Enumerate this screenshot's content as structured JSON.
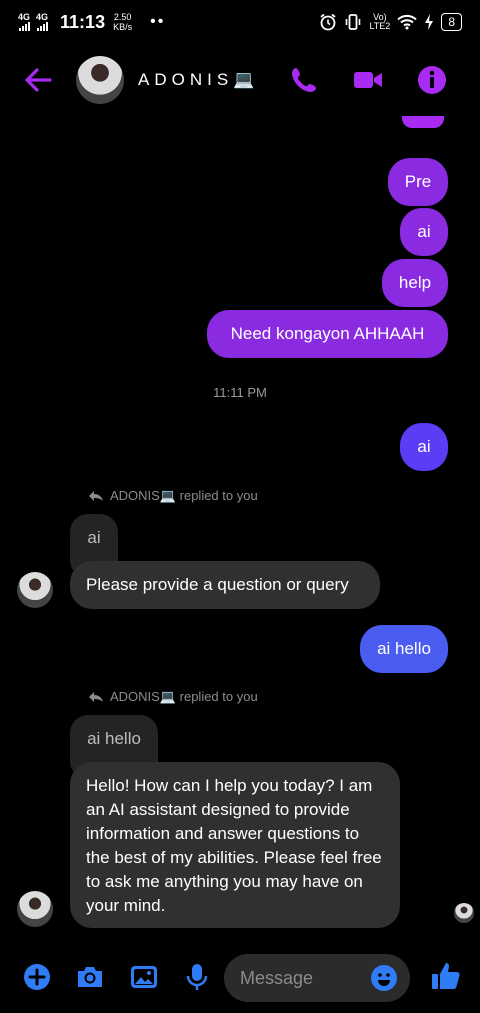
{
  "status": {
    "net1": "4G",
    "net2": "4G",
    "time": "11:13",
    "speed_value": "2.50",
    "speed_unit": "KB/s",
    "dots": "••",
    "volte_top": "Vo)",
    "volte_bottom": "LTE2",
    "battery": "8"
  },
  "header": {
    "name": "ADONIS💻",
    "accent": "#a72bf0"
  },
  "messages": {
    "sent1": "Pre",
    "sent2": "ai",
    "sent3": "help",
    "sent4": "Need kongayon AHHAAH",
    "time1": "11:11 PM",
    "sent5": "ai",
    "reply1_note": "ADONIS💻 replied to you",
    "quote1": "ai",
    "recv1": "Please provide a question or query",
    "sent6": "ai hello",
    "reply2_note": "ADONIS💻 replied to you",
    "quote2": "ai hello",
    "recv2": "Hello! How can I help you today? I am an AI assistant designed to provide information and answer questions to the best of my abilities. Please feel free to ask me anything you may have on your mind."
  },
  "composer": {
    "placeholder": "Message",
    "accent": "#2f7cf6"
  }
}
